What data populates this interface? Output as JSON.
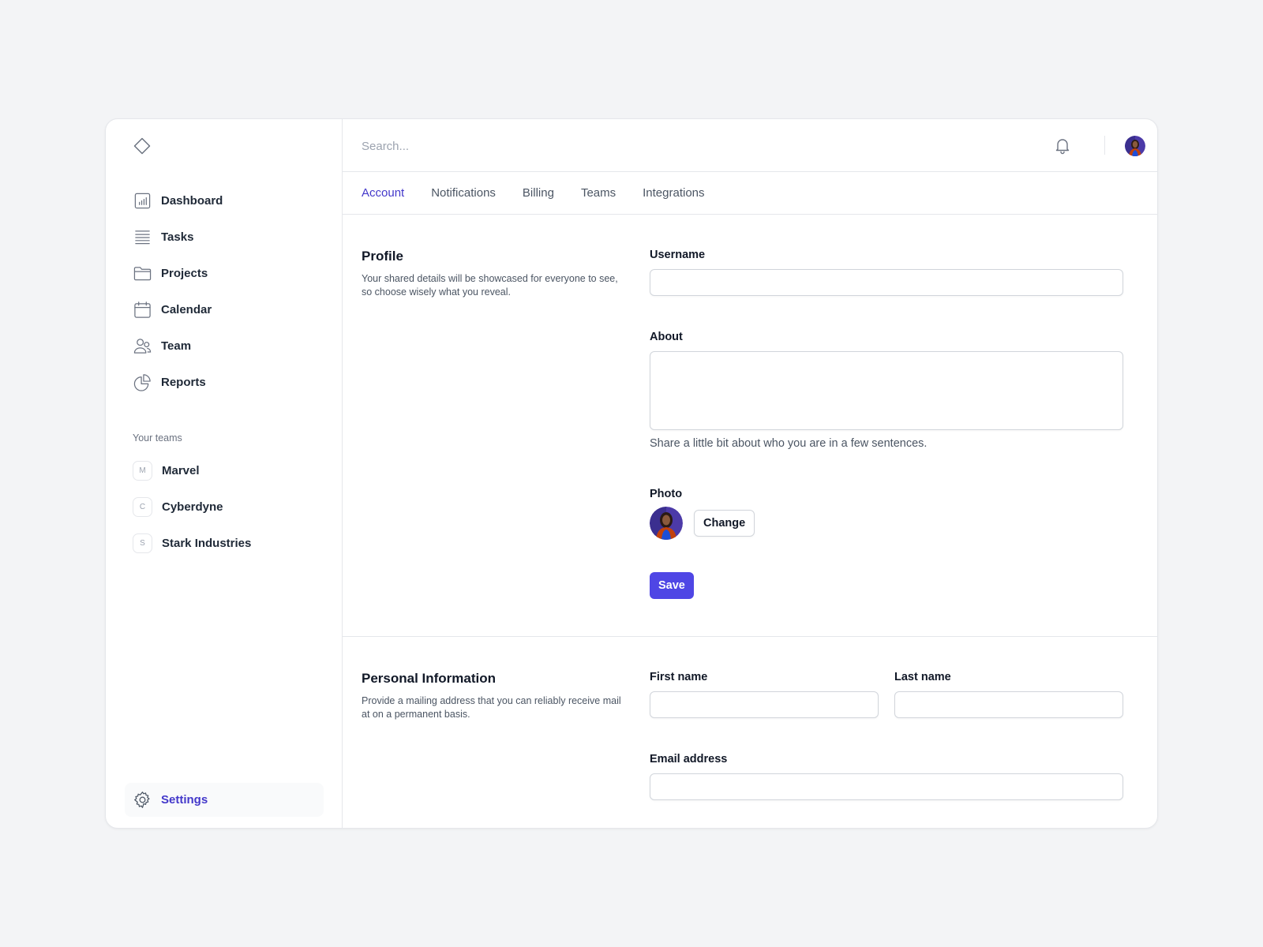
{
  "colors": {
    "accent": "#4f46e5",
    "active_text": "#4338ca",
    "background": "#f3f4f6"
  },
  "sidebar": {
    "logo_icon": "diamond-icon",
    "items": [
      {
        "label": "Dashboard",
        "icon": "bar-chart-icon"
      },
      {
        "label": "Tasks",
        "icon": "list-icon"
      },
      {
        "label": "Projects",
        "icon": "folder-icon"
      },
      {
        "label": "Calendar",
        "icon": "calendar-icon"
      },
      {
        "label": "Team",
        "icon": "users-icon"
      },
      {
        "label": "Reports",
        "icon": "pie-chart-icon"
      }
    ],
    "teams_heading": "Your teams",
    "teams": [
      {
        "initial": "M",
        "name": "Marvel"
      },
      {
        "initial": "C",
        "name": "Cyberdyne"
      },
      {
        "initial": "S",
        "name": "Stark Industries"
      }
    ],
    "settings": {
      "label": "Settings",
      "icon": "gear-icon"
    }
  },
  "topbar": {
    "search_placeholder": "Search...",
    "bell_icon": "bell-icon"
  },
  "tabs": [
    {
      "label": "Account",
      "active": true
    },
    {
      "label": "Notifications",
      "active": false
    },
    {
      "label": "Billing",
      "active": false
    },
    {
      "label": "Teams",
      "active": false
    },
    {
      "label": "Integrations",
      "active": false
    }
  ],
  "profile": {
    "title": "Profile",
    "description": "Your shared details will be showcased for everyone to see, so choose wisely what you reveal.",
    "username_label": "Username",
    "username_value": "",
    "about_label": "About",
    "about_value": "",
    "about_hint": "Share a little bit about who you are in a few sentences.",
    "photo_label": "Photo",
    "change_button": "Change",
    "save_button": "Save"
  },
  "personal": {
    "title": "Personal Information",
    "description": "Provide a mailing address that you can reliably receive mail at on a permanent basis.",
    "first_name_label": "First name",
    "first_name_value": "",
    "last_name_label": "Last name",
    "last_name_value": "",
    "email_label": "Email address",
    "email_value": ""
  }
}
